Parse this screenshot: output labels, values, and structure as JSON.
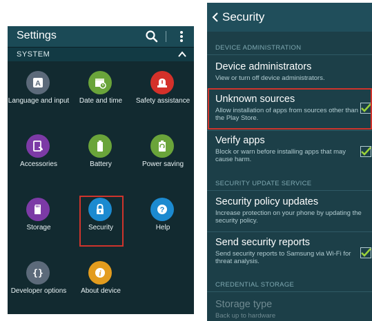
{
  "left": {
    "header": {
      "title": "Settings"
    },
    "section": {
      "label": "SYSTEM"
    },
    "items": [
      {
        "label": "Language and input",
        "icon": "language-icon",
        "color": "#5c6a7a"
      },
      {
        "label": "Date and time",
        "icon": "calendar-icon",
        "color": "#6aa43a"
      },
      {
        "label": "Safety assistance",
        "icon": "warning-icon",
        "color": "#d4312a"
      },
      {
        "label": "Accessories",
        "icon": "accessory-icon",
        "color": "#7c3aa6"
      },
      {
        "label": "Battery",
        "icon": "battery-icon",
        "color": "#6aa43a"
      },
      {
        "label": "Power saving",
        "icon": "recycle-icon",
        "color": "#6aa43a"
      },
      {
        "label": "Storage",
        "icon": "sd-card-icon",
        "color": "#7c3aa6"
      },
      {
        "label": "Security",
        "icon": "lock-icon",
        "color": "#1c8ad0"
      },
      {
        "label": "Help",
        "icon": "question-icon",
        "color": "#1c8ad0"
      },
      {
        "label": "Developer options",
        "icon": "braces-icon",
        "color": "#5c6a7a"
      },
      {
        "label": "About device",
        "icon": "info-icon",
        "color": "#e39c1e"
      }
    ]
  },
  "right": {
    "header": {
      "title": "Security"
    },
    "sections": {
      "device_admin": "DEVICE ADMINISTRATION",
      "update_service": "SECURITY UPDATE SERVICE",
      "credential_storage": "CREDENTIAL STORAGE"
    },
    "items": {
      "device_admins": {
        "title": "Device administrators",
        "subtitle": "View or turn off device administrators."
      },
      "unknown_sources": {
        "title": "Unknown sources",
        "subtitle": "Allow installation of apps from sources other than the Play Store.",
        "checked": true
      },
      "verify_apps": {
        "title": "Verify apps",
        "subtitle": "Block or warn before installing apps that may cause harm.",
        "checked": true
      },
      "policy_updates": {
        "title": "Security policy updates",
        "subtitle": "Increase protection on your phone by updating the security policy."
      },
      "send_reports": {
        "title": "Send security reports",
        "subtitle": "Send security reports to Samsung via Wi-Fi for threat analysis.",
        "checked": true
      },
      "storage_type": {
        "title": "Storage type",
        "subtitle": "Back up to hardware"
      }
    }
  },
  "colors": {
    "accent": "#d0342c",
    "check": "#9ad23a"
  }
}
